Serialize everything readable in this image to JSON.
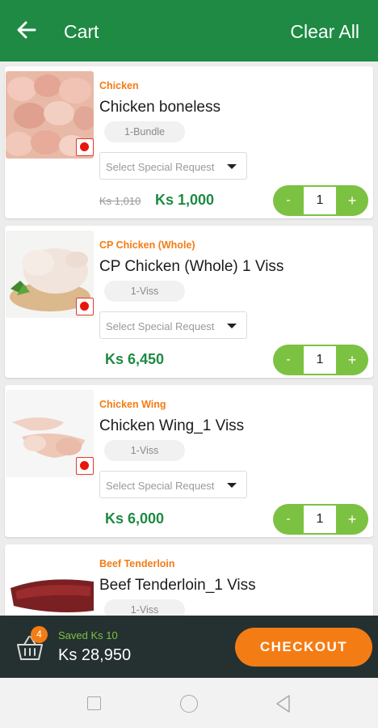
{
  "header": {
    "title": "Cart",
    "clear_all": "Clear All"
  },
  "items": [
    {
      "category": "Chicken",
      "name": "Chicken boneless",
      "unit": "1-Bundle",
      "request_placeholder": "Select Special Request",
      "old_price": "Ks 1,010",
      "price": "Ks 1,000",
      "qty": "1",
      "minus": "-",
      "plus": "+"
    },
    {
      "category": "CP Chicken (Whole)",
      "name": "CP Chicken (Whole) 1 Viss",
      "unit": "1-Viss",
      "request_placeholder": "Select Special Request",
      "old_price": "",
      "price": "Ks 6,450",
      "qty": "1",
      "minus": "-",
      "plus": "+"
    },
    {
      "category": "Chicken Wing",
      "name": "Chicken Wing_1 Viss",
      "unit": "1-Viss",
      "request_placeholder": "Select Special Request",
      "old_price": "",
      "price": "Ks 6,000",
      "qty": "1",
      "minus": "-",
      "plus": "+"
    },
    {
      "category": "Beef Tenderloin",
      "name": "Beef Tenderloin_1 Viss",
      "unit": "1-Viss"
    }
  ],
  "summary": {
    "count": "4",
    "saved": "Saved Ks 10",
    "total": "Ks 28,950",
    "checkout": "CHECKOUT"
  },
  "colors": {
    "primary": "#1e8a43",
    "accent": "#f47c14",
    "stepper": "#7cc242",
    "bottom_bar": "#253130"
  },
  "icons": {
    "back": "arrow-left-icon",
    "basket": "basket-icon",
    "veg_mark": "red-dot-icon",
    "nav": [
      "square-icon",
      "circle-icon",
      "triangle-back-icon"
    ]
  }
}
